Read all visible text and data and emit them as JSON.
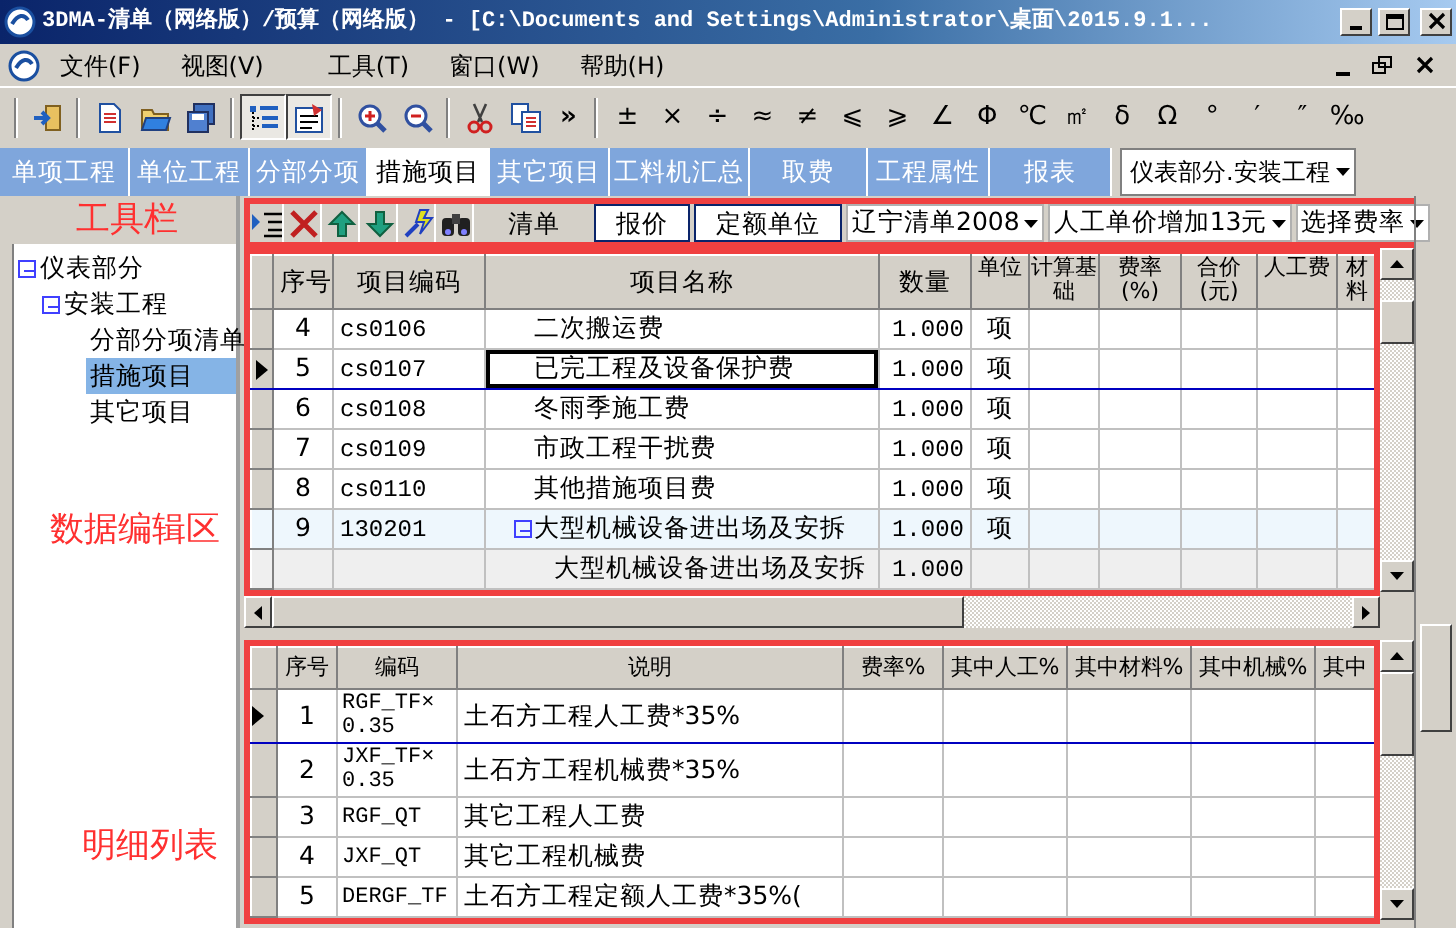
{
  "window": {
    "title": "3DMA-清单（网络版）/预算（网络版） - [C:\\Documents and Settings\\Administrator\\桌面\\2015.9.1..."
  },
  "menu": [
    "文件(F)",
    "视图(V)",
    "工具(T)",
    "窗口(W)",
    "帮助(H)"
  ],
  "toolbar": {
    "buttons": [
      {
        "kind": "exit",
        "pressed": false
      },
      {
        "kind": "new",
        "pressed": false
      },
      {
        "kind": "open",
        "pressed": false
      },
      {
        "kind": "saveall",
        "pressed": false
      },
      {
        "kind": "tree",
        "pressed": true
      },
      {
        "kind": "form",
        "pressed": true
      },
      {
        "kind": "zoomin",
        "pressed": false
      },
      {
        "kind": "zoomout",
        "pressed": false
      },
      {
        "kind": "cut",
        "pressed": false
      },
      {
        "kind": "copy",
        "pressed": false
      }
    ],
    "overflow": "»",
    "symbols": [
      "±",
      "×",
      "÷",
      "≈",
      "≠",
      "⩽",
      "⩾",
      "∠",
      "Φ",
      "℃",
      "㎡",
      "δ",
      "Ω",
      "°",
      "′",
      "″",
      "‰"
    ]
  },
  "tabs": [
    {
      "label": "单项工程",
      "selected": false
    },
    {
      "label": "单位工程",
      "selected": false
    },
    {
      "label": "分部分项",
      "selected": false
    },
    {
      "label": "措施项目",
      "selected": true
    },
    {
      "label": "其它项目",
      "selected": false
    },
    {
      "label": "工料机汇总",
      "selected": false
    },
    {
      "label": "取费",
      "selected": false
    },
    {
      "label": "工程属性",
      "selected": false
    },
    {
      "label": "报表",
      "selected": false
    }
  ],
  "unit_select": {
    "value": "仪表部分.安装工程"
  },
  "annotations": [
    "工具栏",
    "数据编辑区",
    "明细列表"
  ],
  "tree": [
    {
      "label": "仪表部分",
      "expanded": true,
      "selected": false,
      "children": [
        {
          "label": "安装工程",
          "expanded": true,
          "selected": false,
          "children": [
            {
              "label": "分部分项清单",
              "selected": false
            },
            {
              "label": "措施项目",
              "selected": true
            },
            {
              "label": "其它项目",
              "selected": false
            }
          ]
        }
      ]
    }
  ],
  "edit_toolbar": {
    "icons": [
      {
        "kind": "insert"
      },
      {
        "kind": "delete"
      },
      {
        "kind": "up"
      },
      {
        "kind": "down"
      },
      {
        "kind": "wand"
      },
      {
        "kind": "find"
      }
    ],
    "buttons": [
      {
        "label": "清单",
        "selected": false
      },
      {
        "label": "报价",
        "selected": true
      },
      {
        "label": "定额单位",
        "selected": true
      }
    ],
    "selects": [
      "辽宁清单2008",
      "人工单价增加13元",
      "选择费率"
    ]
  },
  "items_table": {
    "columns": [
      "序号",
      "项目编码",
      "项目名称",
      "数量",
      "单位",
      "计算基础",
      "费率(%)",
      "合价(元)",
      "人工费",
      "材料"
    ],
    "rows": [
      {
        "kind": "item",
        "no": "4",
        "code": "cs0106",
        "name": "二次搬运费",
        "quantity": "1.000",
        "unit": "项",
        "selected": false
      },
      {
        "kind": "item",
        "no": "5",
        "code": "cs0107",
        "name": "已完工程及设备保护费",
        "quantity": "1.000",
        "unit": "项",
        "selected": true
      },
      {
        "kind": "item",
        "no": "6",
        "code": "cs0108",
        "name": "冬雨季施工费",
        "quantity": "1.000",
        "unit": "项",
        "selected": false
      },
      {
        "kind": "item",
        "no": "7",
        "code": "cs0109",
        "name": "市政工程干扰费",
        "quantity": "1.000",
        "unit": "项",
        "selected": false
      },
      {
        "kind": "item",
        "no": "8",
        "code": "cs0110",
        "name": "其他措施项目费",
        "quantity": "1.000",
        "unit": "项",
        "selected": false
      },
      {
        "kind": "group",
        "no": "9",
        "code": "130201",
        "name": "大型机械设备进出场及安拆",
        "quantity": "1.000",
        "unit": "项",
        "expanded": true,
        "selected": false
      },
      {
        "kind": "child",
        "name": "大型机械设备进出场及安拆",
        "quantity": "1.000",
        "selected": false
      }
    ]
  },
  "detail_table": {
    "columns": [
      "序号",
      "编码",
      "说明",
      "费率%",
      "其中人工%",
      "其中材料%",
      "其中机械%",
      "其中"
    ],
    "rows": [
      {
        "no": "1",
        "code": "RGF_TF×0.35",
        "text": "土石方工程人工费*35%",
        "selected": true
      },
      {
        "no": "2",
        "code": "JXF_TF×0.35",
        "text": "土石方工程机械费*35%",
        "selected": false
      },
      {
        "no": "3",
        "code": "RGF_QT",
        "text": "其它工程人工费",
        "selected": false
      },
      {
        "no": "4",
        "code": "JXF_QT",
        "text": "其它工程机械费",
        "selected": false
      },
      {
        "no": "5",
        "code": "DERGF_TF",
        "text": "土石方工程定额人工费*35%(",
        "selected": false
      }
    ]
  }
}
